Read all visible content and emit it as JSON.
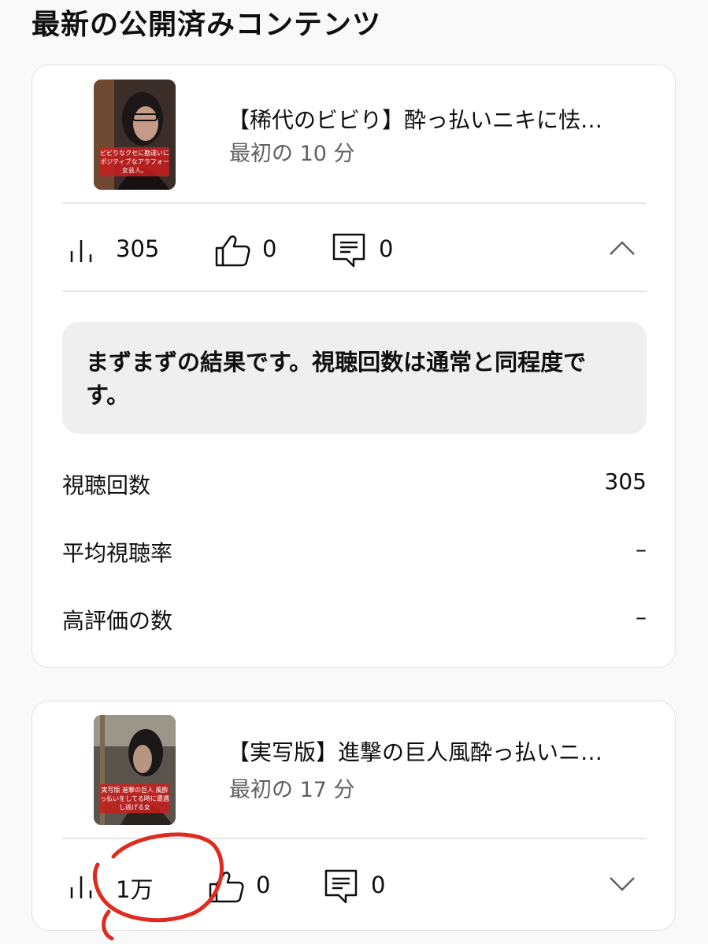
{
  "section_title": "最新の公開済みコンテンツ",
  "videos": [
    {
      "title": "【稀代のビビり】酔っ払いニキに怯…",
      "subtitle": "最初の 10 分",
      "thumbnail_caption": "ビビりなクセに勘違いにポジティブなアラフォー女芸人。",
      "stats": {
        "views": "305",
        "likes": "0",
        "comments": "0"
      },
      "expanded": true,
      "feedback": "まずまずの結果です。視聴回数は通常と同程度です。",
      "metrics": [
        {
          "label": "視聴回数",
          "value": "305"
        },
        {
          "label": "平均視聴率",
          "value": "–"
        },
        {
          "label": "高評価の数",
          "value": "–"
        }
      ]
    },
    {
      "title": "【実写版】進撃の巨人風酔っ払いニ…",
      "subtitle": "最初の 17 分",
      "thumbnail_caption": "実写版 進撃の巨人 風酔っ払いをしてる時に遭遇し逃げる女",
      "stats": {
        "views": "1万",
        "likes": "0",
        "comments": "0"
      },
      "expanded": false
    }
  ],
  "icons": {
    "views": "bar-chart-icon",
    "likes": "thumbs-up-icon",
    "comments": "comment-icon",
    "collapse": "chevron-up-icon",
    "expand": "chevron-down-icon"
  },
  "colors": {
    "annotation": "#e02a1f",
    "secondary_text": "#606060",
    "feedback_bg": "#efefef"
  }
}
